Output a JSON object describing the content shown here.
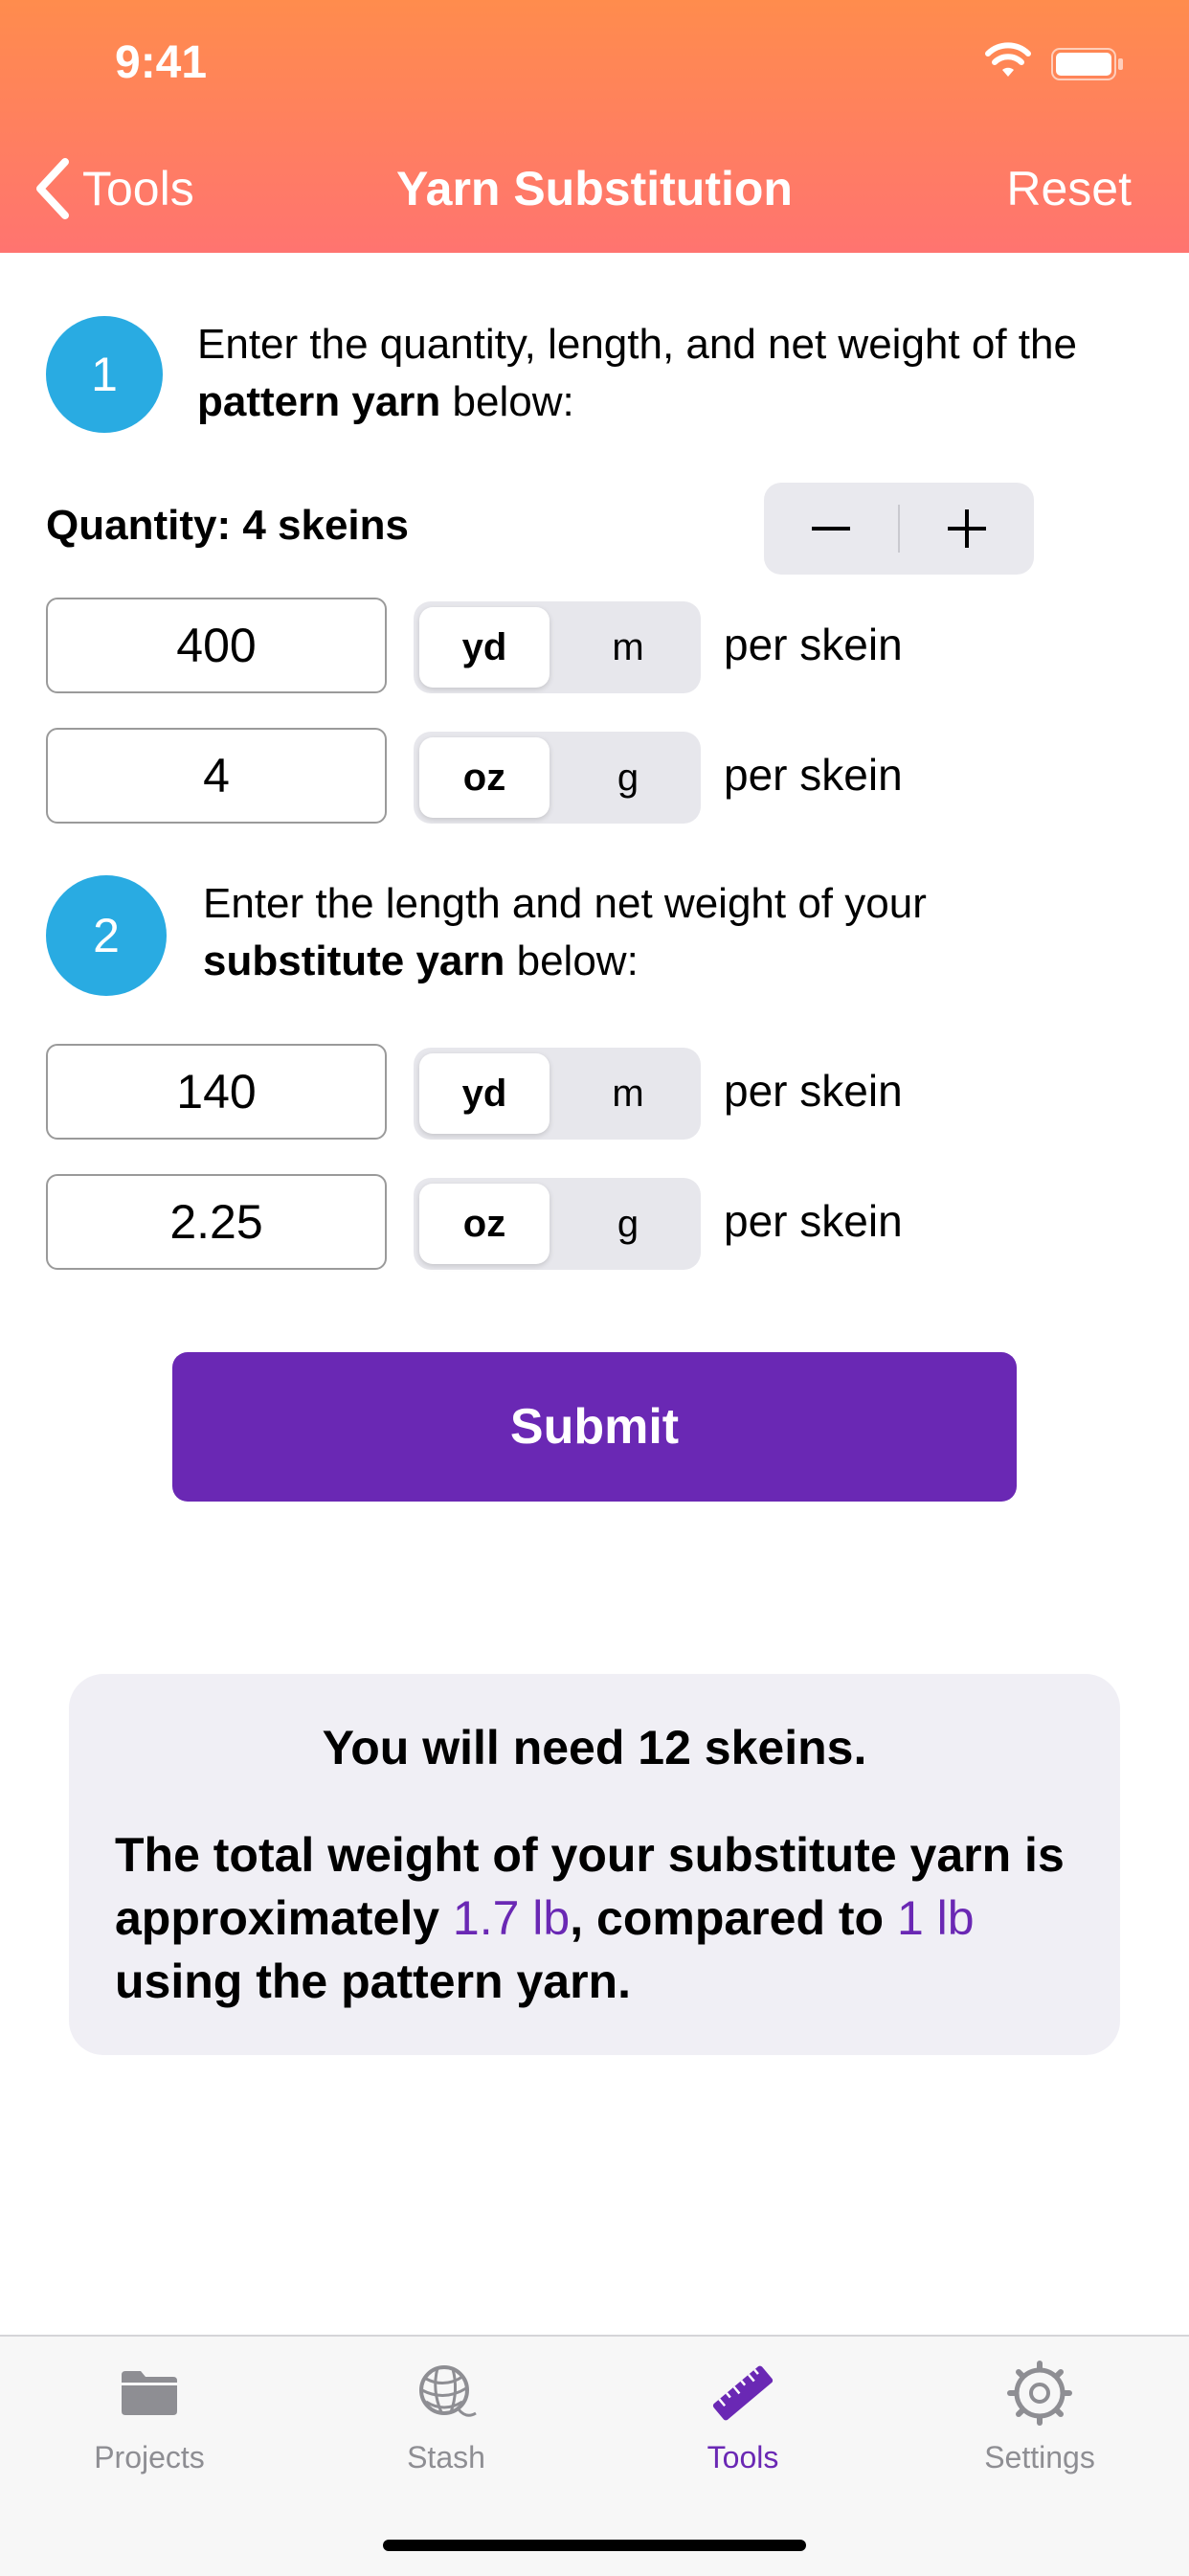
{
  "status_bar": {
    "time": "9:41"
  },
  "nav": {
    "back_label": "Tools",
    "title": "Yarn Substitution",
    "reset_label": "Reset"
  },
  "step1": {
    "number": "1",
    "text_prefix": "Enter the quantity, length, and net weight of the",
    "text_bold": "pattern yarn",
    "text_suffix": " below:",
    "quantity_label": "Quantity: 4 skeins",
    "length_value": "400",
    "length_units": [
      "yd",
      "m"
    ],
    "length_selected": "yd",
    "weight_value": "4",
    "weight_units": [
      "oz",
      "g"
    ],
    "weight_selected": "oz",
    "per_label": "per skein"
  },
  "step2": {
    "number": "2",
    "text_prefix": "Enter the length and net weight of your",
    "text_bold": "substitute yarn",
    "text_suffix": " below:",
    "length_value": "140",
    "length_units": [
      "yd",
      "m"
    ],
    "length_selected": "yd",
    "weight_value": "2.25",
    "weight_units": [
      "oz",
      "g"
    ],
    "weight_selected": "oz",
    "per_label": "per skein"
  },
  "submit_label": "Submit",
  "result": {
    "need_text": "You will need 12 skeins.",
    "desc_part1": "The total weight of your substitute yarn is approximately ",
    "substitute_weight": "1.7 lb",
    "desc_part2": ", compared to ",
    "pattern_weight": "1 lb",
    "desc_part3": " using the pattern yarn."
  },
  "tabs": [
    {
      "label": "Projects",
      "icon": "folder-icon"
    },
    {
      "label": "Stash",
      "icon": "yarn-ball-icon"
    },
    {
      "label": "Tools",
      "icon": "ruler-icon",
      "active": true
    },
    {
      "label": "Settings",
      "icon": "gear-icon"
    }
  ],
  "colors": {
    "accent": "#6a28b4",
    "step_circle": "#29abe2",
    "header_top": "#ff8c4d",
    "header_bottom": "#ff7470"
  }
}
